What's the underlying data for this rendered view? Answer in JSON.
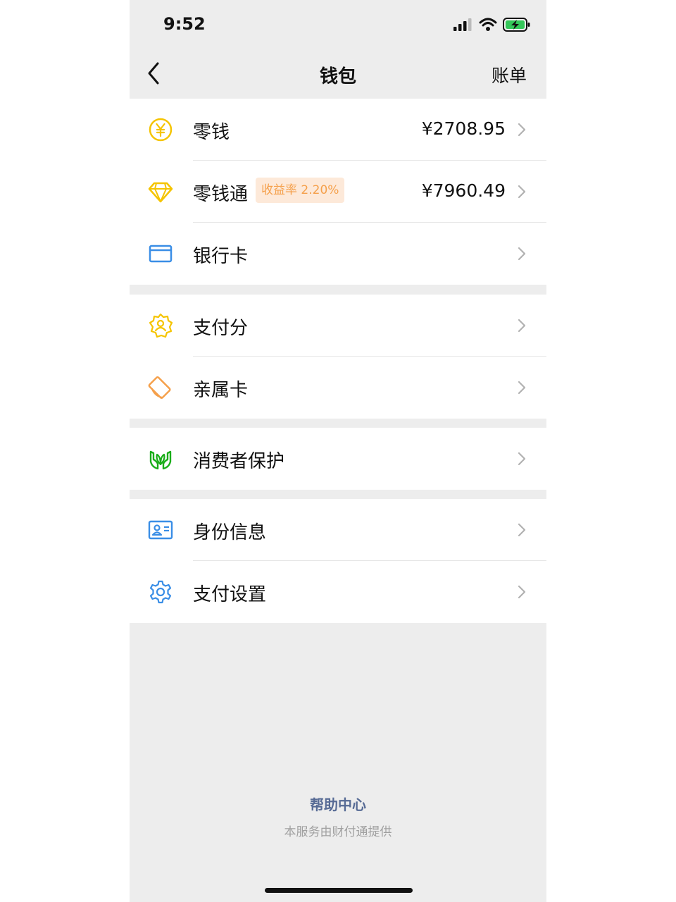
{
  "status_bar": {
    "time": "9:52"
  },
  "nav": {
    "title": "钱包",
    "bill": "账单"
  },
  "groups": [
    {
      "items": [
        {
          "label": "零钱",
          "amount": "¥2708.95",
          "icon": "yuan-coin-icon"
        },
        {
          "label": "零钱通",
          "badge": "收益率 2.20%",
          "amount": "¥7960.49",
          "icon": "diamond-icon"
        },
        {
          "label": "银行卡",
          "icon": "bank-card-icon"
        }
      ]
    },
    {
      "items": [
        {
          "label": "支付分",
          "icon": "pay-score-icon"
        },
        {
          "label": "亲属卡",
          "icon": "family-card-icon"
        }
      ]
    },
    {
      "items": [
        {
          "label": "消费者保护",
          "icon": "consumer-protection-icon"
        }
      ]
    },
    {
      "items": [
        {
          "label": "身份信息",
          "icon": "id-card-icon"
        },
        {
          "label": "支付设置",
          "icon": "gear-icon"
        }
      ]
    }
  ],
  "footer": {
    "help": "帮助中心",
    "note": "本服务由财付通提供"
  },
  "colors": {
    "background": "#ededed",
    "yellow": "#f5c400",
    "orange": "#f5a04b",
    "blue": "#3a8ee6",
    "green": "#1aad19",
    "link": "#576b95"
  }
}
